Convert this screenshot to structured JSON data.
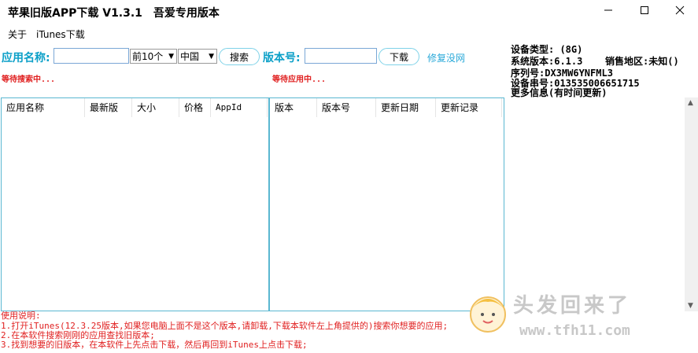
{
  "window": {
    "title": "苹果旧版APP下载 V1.3.1　吾爱专用版本"
  },
  "menu": {
    "about": "关于",
    "itunes_download": "iTunes下载"
  },
  "search": {
    "app_name_label": "应用名称:",
    "app_name_value": "",
    "count_select": "前10个",
    "region_select": "中国",
    "search_button": "搜索",
    "version_label": "版本号:",
    "version_value": "",
    "download_button": "下载",
    "fix_link": "修复没网",
    "status_search": "等待搜索中...",
    "status_app": "等待应用中..."
  },
  "device": {
    "type": "设备类型: (8G)",
    "os_version": "系统版本:6.1.3",
    "sales_region": "销售地区:未知()",
    "serial": "序列号:DX3MW6YNFML3",
    "serial_code": "设备串号:013535006651715",
    "more_info": "更多信息(有时间更新)"
  },
  "left_table": {
    "columns": [
      "应用名称",
      "最新版",
      "大小",
      "价格",
      "AppId"
    ]
  },
  "right_table": {
    "columns": [
      "版本",
      "版本号",
      "更新日期",
      "更新记录"
    ]
  },
  "help": {
    "title": "使用说明:",
    "line1": "1.打开iTunes(12.3.25版本,如果您电脑上面不是这个版本,请卸载,下载本软件左上角提供的)搜索你想要的应用;",
    "line2": "2.在本软件搜索刚刚的应用查找旧版本;",
    "line3": "3.找到想要的旧版本，在本软件上先点击下载，然后再回到iTunes上点击下载;"
  },
  "watermark": {
    "text": "头发回来了",
    "url": "www.tfh11.com"
  }
}
